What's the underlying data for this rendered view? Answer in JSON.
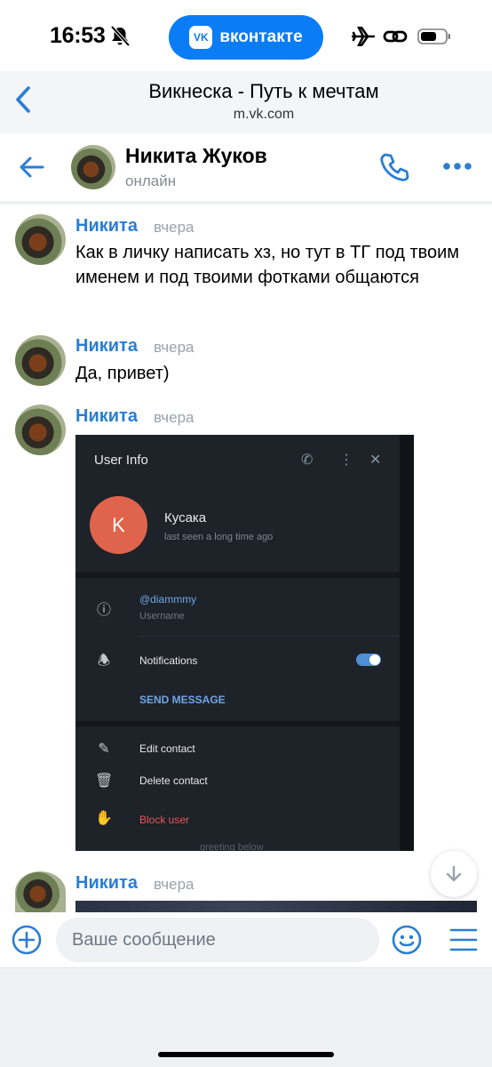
{
  "status_bar": {
    "time": "16:53",
    "app_pill_label": "вконтакте",
    "app_pill_logo": "VK"
  },
  "browser": {
    "title": "Викнеска - Путь к мечтам",
    "url": "m.vk.com"
  },
  "chat": {
    "name": "Никита Жуков",
    "status": "онлайн"
  },
  "messages": [
    {
      "author": "Никита",
      "time": "вчера",
      "text": "Как в личку написать хз, но тут в ТГ под твоим именем и под твоими фотками общаются"
    },
    {
      "author": "Никита",
      "time": "вчера",
      "text": "Да, привет)"
    },
    {
      "author": "Никита",
      "time": "вчера"
    },
    {
      "author": "Никита",
      "time": "вчера"
    }
  ],
  "attachment": {
    "panel_title": "User Info",
    "avatar_letter": "K",
    "contact_name": "Кусака",
    "last_seen": "last seen a long time ago",
    "username": "@diammmy",
    "username_label": "Username",
    "notifications_label": "Notifications",
    "send_message": "SEND MESSAGE",
    "edit_contact": "Edit contact",
    "delete_contact": "Delete contact",
    "block_user": "Block user",
    "cut_text": "greeting below"
  },
  "composer": {
    "placeholder": "Ваше сообщение"
  },
  "colors": {
    "accent": "#2a7ed3",
    "vk_blue": "#0a7cf5"
  }
}
